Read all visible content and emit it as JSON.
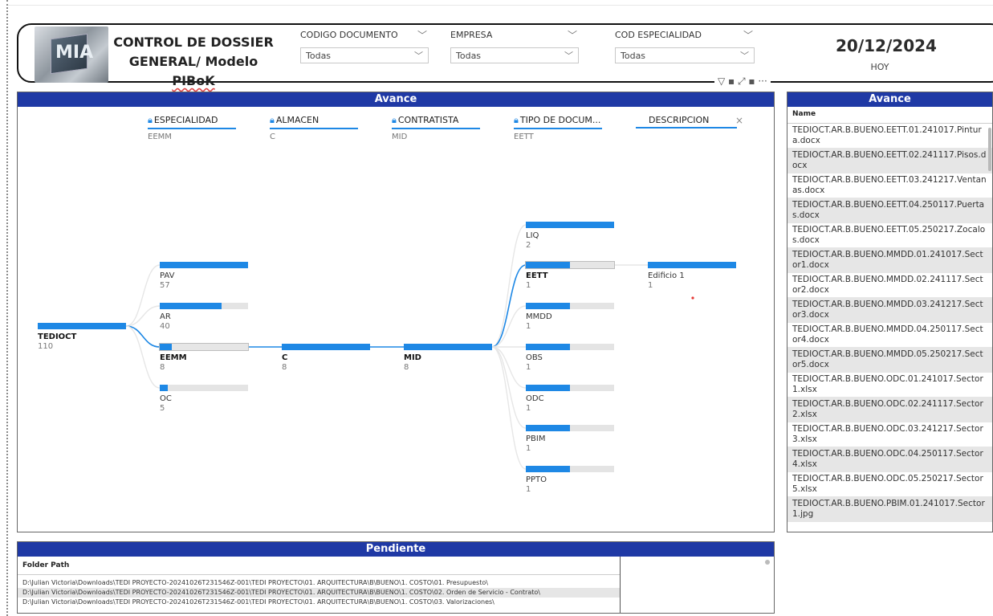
{
  "header": {
    "title_line1": "CONTROL DE DOSSIER",
    "title_line2_a": "GENERAL/ Modelo ",
    "title_line2_b": "PIBoK",
    "logo_icon": "mia-logo",
    "slicers": [
      {
        "label": "CODIGO DOCUMENTO",
        "value": "Todas"
      },
      {
        "label": "EMPRESA",
        "value": "Todas"
      },
      {
        "label": "COD ESPECIALIDAD",
        "value": "Todas"
      }
    ],
    "date": "20/12/2024",
    "date_caption": "HOY",
    "visual_icons": "▽ ▪ ⤢ ▪ ···"
  },
  "avance": {
    "title": "Avance",
    "levels": [
      {
        "label": "ESPECIALIDAD",
        "value": "EEMM",
        "locked": true
      },
      {
        "label": "ALMACEN",
        "value": "C",
        "locked": true
      },
      {
        "label": "CONTRATISTA",
        "value": "MID",
        "locked": true
      },
      {
        "label": "TIPO DE DOCUM...",
        "value": "EETT",
        "locked": true
      },
      {
        "label": "DESCRIPCION",
        "value": "",
        "locked": false
      }
    ],
    "close_icon": "×",
    "root": {
      "name": "TEDIOCT",
      "count": "110",
      "fill": 1.0
    },
    "especialidad": [
      {
        "name": "PAV",
        "count": "57",
        "fill": 1.0,
        "selected": false
      },
      {
        "name": "AR",
        "count": "40",
        "fill": 0.7,
        "selected": false
      },
      {
        "name": "EEMM",
        "count": "8",
        "fill": 0.14,
        "selected": true
      },
      {
        "name": "OC",
        "count": "5",
        "fill": 0.09,
        "selected": false
      }
    ],
    "almacen": [
      {
        "name": "C",
        "count": "8",
        "fill": 1.0,
        "selected": true
      }
    ],
    "contratista": [
      {
        "name": "MID",
        "count": "8",
        "fill": 1.0,
        "selected": true
      }
    ],
    "tipo": [
      {
        "name": "LIQ",
        "count": "2",
        "fill": 1.0,
        "selected": false
      },
      {
        "name": "EETT",
        "count": "1",
        "fill": 0.5,
        "selected": true
      },
      {
        "name": "MMDD",
        "count": "1",
        "fill": 0.5,
        "selected": false
      },
      {
        "name": "OBS",
        "count": "1",
        "fill": 0.5,
        "selected": false
      },
      {
        "name": "ODC",
        "count": "1",
        "fill": 0.5,
        "selected": false
      },
      {
        "name": "PBIM",
        "count": "1",
        "fill": 0.5,
        "selected": false
      },
      {
        "name": "PPTO",
        "count": "1",
        "fill": 0.5,
        "selected": false
      }
    ],
    "descripcion": [
      {
        "name": "Edificio 1",
        "count": "1",
        "fill": 1.0,
        "selected": false
      }
    ]
  },
  "avance_table": {
    "title": "Avance",
    "column": "Name",
    "rows": [
      "TEDIOCT.AR.B.BUENO.EETT.01.241017.Pintura.docx",
      "TEDIOCT.AR.B.BUENO.EETT.02.241117.Pisos.docx",
      "TEDIOCT.AR.B.BUENO.EETT.03.241217.Ventanas.docx",
      "TEDIOCT.AR.B.BUENO.EETT.04.250117.Puertas.docx",
      "TEDIOCT.AR.B.BUENO.EETT.05.250217.Zocalos.docx",
      "TEDIOCT.AR.B.BUENO.MMDD.01.241017.Sector1.docx",
      "TEDIOCT.AR.B.BUENO.MMDD.02.241117.Sector2.docx",
      "TEDIOCT.AR.B.BUENO.MMDD.03.241217.Sector3.docx",
      "TEDIOCT.AR.B.BUENO.MMDD.04.250117.Sector4.docx",
      "TEDIOCT.AR.B.BUENO.MMDD.05.250217.Sector5.docx",
      "TEDIOCT.AR.B.BUENO.ODC.01.241017.Sector1.xlsx",
      "TEDIOCT.AR.B.BUENO.ODC.02.241117.Sector2.xlsx",
      "TEDIOCT.AR.B.BUENO.ODC.03.241217.Sector3.xlsx",
      "TEDIOCT.AR.B.BUENO.ODC.04.250117.Sector4.xlsx",
      "TEDIOCT.AR.B.BUENO.ODC.05.250217.Sector5.xlsx",
      "TEDIOCT.AR.B.BUENO.PBIM.01.241017.Sector1.jpg"
    ]
  },
  "pendiente": {
    "title": "Pendiente",
    "column": "Folder Path",
    "rows": [
      "D:\\Julian Victoria\\Downloads\\TEDI PROYECTO-20241026T231546Z-001\\TEDI PROYECTO\\01. ARQUITECTURA\\B\\BUENO\\1. COSTO\\01. Presupuesto\\",
      "D:\\Julian Victoria\\Downloads\\TEDI PROYECTO-20241026T231546Z-001\\TEDI PROYECTO\\01. ARQUITECTURA\\B\\BUENO\\1. COSTO\\02. Orden de Servicio - Contrato\\",
      "D:\\Julian Victoria\\Downloads\\TEDI PROYECTO-20241026T231546Z-001\\TEDI PROYECTO\\01. ARQUITECTURA\\B\\BUENO\\1. COSTO\\03. Valorizaciones\\"
    ]
  },
  "colors": {
    "accent": "#1e88e5",
    "title_bar": "#1f39a5",
    "bar_bg": "#e4e4e4"
  }
}
